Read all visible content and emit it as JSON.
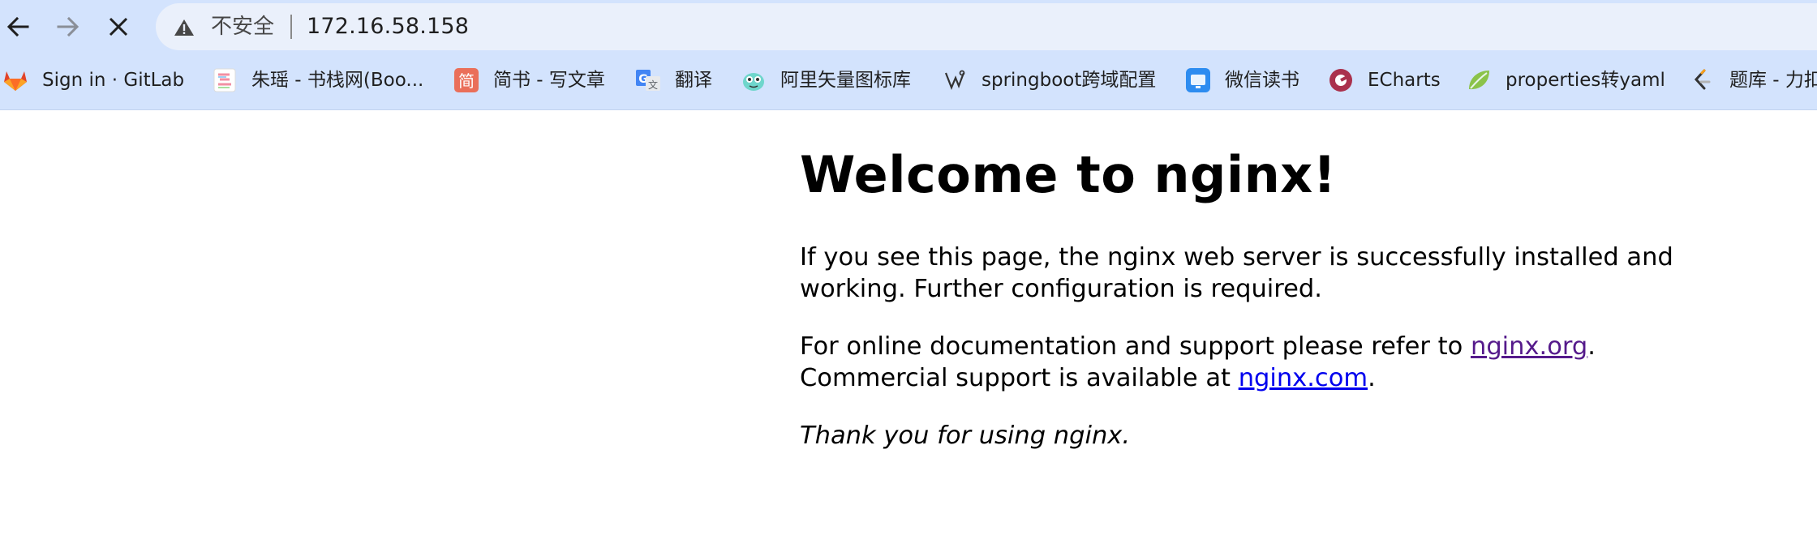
{
  "browser": {
    "security_label": "不安全",
    "url": "172.16.58.158",
    "bookmarks": [
      {
        "label": "Sign in · GitLab",
        "icon": "gitlab-icon"
      },
      {
        "label": "朱瑶 - 书栈网(Boo...",
        "icon": "bookstack-icon"
      },
      {
        "label": "简书 - 写文章",
        "icon": "jianshu-icon"
      },
      {
        "label": "翻译",
        "icon": "google-translate-icon"
      },
      {
        "label": "阿里矢量图标库",
        "icon": "iconfont-icon"
      },
      {
        "label": "springboot跨域配置",
        "icon": "springboot-icon"
      },
      {
        "label": "微信读书",
        "icon": "weread-icon"
      },
      {
        "label": "ECharts",
        "icon": "echarts-icon"
      },
      {
        "label": "properties转yaml",
        "icon": "leaf-icon"
      },
      {
        "label": "题库 - 力扣",
        "icon": "leetcode-icon"
      }
    ],
    "colors": {
      "chrome_bg": "#d3e3fd",
      "omnibox_bg": "#eaf0fb"
    }
  },
  "page": {
    "title": "Welcome to nginx!",
    "p1_line1": "If you see this page, the nginx web server is successfully installed and",
    "p1_line2": "working. Further configuration is required.",
    "p2_text1": "For online documentation and support please refer to ",
    "p2_link1": "nginx.org",
    "p2_text2": ".",
    "p2_text3": "Commercial support is available at ",
    "p2_link2": "nginx.com",
    "p2_text4": ".",
    "p3": "Thank you for using nginx.",
    "colors": {
      "visited_link": "#551a8b",
      "link": "#0000ee"
    }
  }
}
